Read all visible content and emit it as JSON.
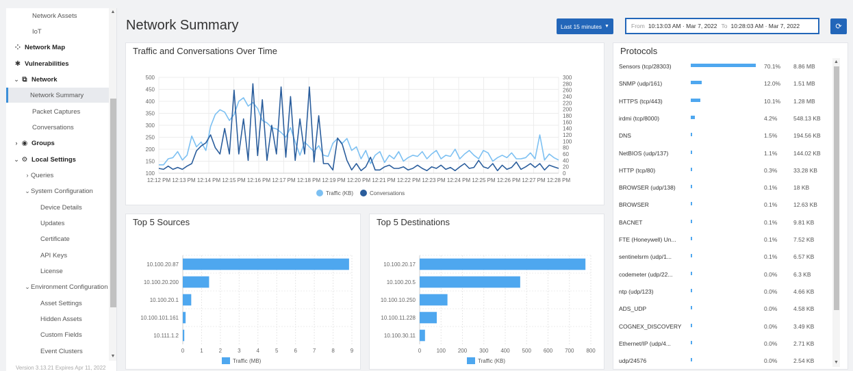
{
  "sidebar": {
    "items": [
      {
        "label": "Network Assets",
        "level": 2
      },
      {
        "label": "IoT",
        "level": 2
      },
      {
        "label": "Network Map",
        "icon": "network-map-icon",
        "bold": true
      },
      {
        "label": "Vulnerabilities",
        "icon": "bug-icon",
        "bold": true
      },
      {
        "label": "Network",
        "icon": "network-icon",
        "bold": true,
        "chevron": "down"
      },
      {
        "label": "Network Summary",
        "level": 2,
        "active": true
      },
      {
        "label": "Packet Captures",
        "level": 2
      },
      {
        "label": "Conversations",
        "level": 2
      },
      {
        "label": "Groups",
        "icon": "groups-icon",
        "bold": true,
        "chevron": "right"
      },
      {
        "label": "Local Settings",
        "icon": "settings-icon",
        "bold": true,
        "chevron": "down"
      },
      {
        "label": "Queries",
        "level": 2,
        "chevron": "right"
      },
      {
        "label": "System Configuration",
        "level": 2,
        "chevron": "down"
      },
      {
        "label": "Device Details",
        "level": 3
      },
      {
        "label": "Updates",
        "level": 3
      },
      {
        "label": "Certificate",
        "level": 3
      },
      {
        "label": "API Keys",
        "level": 3
      },
      {
        "label": "License",
        "level": 3
      },
      {
        "label": "Environment Configuration",
        "level": 2,
        "chevron": "down"
      },
      {
        "label": "Asset Settings",
        "level": 3
      },
      {
        "label": "Hidden Assets",
        "level": 3
      },
      {
        "label": "Custom Fields",
        "level": 3
      },
      {
        "label": "Event Clusters",
        "level": 3
      }
    ],
    "version": "Version 3.13.21 Expires Apr 11, 2022"
  },
  "header": {
    "title": "Network Summary",
    "range_button": "Last 15 minutes",
    "date_from_label": "From",
    "date_from": "10:13:03 AM · Mar 7, 2022",
    "date_to_label": "To",
    "date_to": "10:28:03 AM · Mar 7, 2022"
  },
  "colors": {
    "accent": "#2266b9",
    "bar": "#4ea7ef",
    "traffic_line": "#7cc0f2",
    "conversations_line": "#2a5d9c"
  },
  "traffic_card": {
    "title": "Traffic and Conversations Over Time",
    "legend": [
      "Traffic (KB)",
      "Conversations"
    ]
  },
  "sources_card": {
    "title": "Top 5 Sources",
    "legend": "Traffic (MB)"
  },
  "destinations_card": {
    "title": "Top 5 Destinations",
    "legend": "Traffic (KB)"
  },
  "protocols_card": {
    "title": "Protocols",
    "rows": [
      {
        "name": "Sensors (tcp/28303)",
        "pct": "70.1%",
        "size": "8.86 MB",
        "fraction": 0.701
      },
      {
        "name": "SNMP (udp/161)",
        "pct": "12.0%",
        "size": "1.51 MB",
        "fraction": 0.12
      },
      {
        "name": "HTTPS (tcp/443)",
        "pct": "10.1%",
        "size": "1.28 MB",
        "fraction": 0.101
      },
      {
        "name": "irdmi (tcp/8000)",
        "pct": "4.2%",
        "size": "548.13 KB",
        "fraction": 0.042
      },
      {
        "name": "DNS",
        "pct": "1.5%",
        "size": "194.56 KB",
        "fraction": 0.015
      },
      {
        "name": "NetBIOS (udp/137)",
        "pct": "1.1%",
        "size": "144.02 KB",
        "fraction": 0.011
      },
      {
        "name": "HTTP (tcp/80)",
        "pct": "0.3%",
        "size": "33.28 KB",
        "fraction": 0.003
      },
      {
        "name": "BROWSER (udp/138)",
        "pct": "0.1%",
        "size": "18 KB",
        "fraction": 0.001
      },
      {
        "name": "BROWSER",
        "pct": "0.1%",
        "size": "12.63 KB",
        "fraction": 0.001
      },
      {
        "name": "BACNET",
        "pct": "0.1%",
        "size": "9.81 KB",
        "fraction": 0.001
      },
      {
        "name": "FTE (Honeywell) Un...",
        "pct": "0.1%",
        "size": "7.52 KB",
        "fraction": 0.001
      },
      {
        "name": "sentinelsrm (udp/1...",
        "pct": "0.1%",
        "size": "6.57 KB",
        "fraction": 0.001
      },
      {
        "name": "codemeter (udp/22...",
        "pct": "0.0%",
        "size": "6.3 KB",
        "fraction": 0.0005
      },
      {
        "name": "ntp (udp/123)",
        "pct": "0.0%",
        "size": "4.66 KB",
        "fraction": 0.0005
      },
      {
        "name": "ADS_UDP",
        "pct": "0.0%",
        "size": "4.58 KB",
        "fraction": 0.0005
      },
      {
        "name": "COGNEX_DISCOVERY",
        "pct": "0.0%",
        "size": "3.49 KB",
        "fraction": 0.0005
      },
      {
        "name": "Ethernet/IP (udp/4...",
        "pct": "0.0%",
        "size": "2.71 KB",
        "fraction": 0.0005
      },
      {
        "name": "udp/24576",
        "pct": "0.0%",
        "size": "2.54 KB",
        "fraction": 0.0005
      }
    ]
  },
  "chart_data": [
    {
      "type": "line",
      "title": "Traffic and Conversations Over Time",
      "x": [
        "12:12 PM",
        "12:13 PM",
        "12:14 PM",
        "12:15 PM",
        "12:16 PM",
        "12:17 PM",
        "12:18 PM",
        "12:19 PM",
        "12:20 PM",
        "12:21 PM",
        "12:22 PM",
        "12:23 PM",
        "12:24 PM",
        "12:25 PM",
        "12:26 PM",
        "12:27 PM",
        "12:28 PM"
      ],
      "left_ylim": [
        100,
        500
      ],
      "left_ticks": [
        100,
        150,
        200,
        250,
        300,
        350,
        400,
        450,
        500
      ],
      "right_ylim": [
        0,
        300
      ],
      "right_ticks": [
        0,
        20,
        40,
        60,
        80,
        100,
        120,
        140,
        160,
        180,
        200,
        220,
        240,
        260,
        280,
        300
      ],
      "legend_position": "bottom",
      "series": [
        {
          "name": "Traffic (KB)",
          "axis": "left",
          "color": "#7cc0f2",
          "values": [
            135,
            135,
            160,
            165,
            190,
            155,
            175,
            255,
            210,
            230,
            195,
            295,
            345,
            365,
            355,
            320,
            345,
            400,
            415,
            380,
            395,
            370,
            320,
            310,
            290,
            285,
            270,
            250,
            290,
            230,
            175,
            230,
            210,
            190,
            215,
            175,
            170,
            225,
            245,
            225,
            245,
            195,
            210,
            160,
            195,
            140,
            175,
            190,
            145,
            175,
            160,
            190,
            150,
            165,
            175,
            170,
            190,
            160,
            180,
            195,
            160,
            175,
            170,
            200,
            160,
            180,
            195,
            175,
            160,
            195,
            185,
            150,
            165,
            175,
            165,
            185,
            160,
            160,
            165,
            185,
            160,
            260,
            155,
            180,
            165,
            155
          ]
        },
        {
          "name": "Conversations",
          "axis": "right",
          "color": "#2a5d9c",
          "values": [
            15,
            12,
            22,
            12,
            18,
            12,
            22,
            30,
            70,
            85,
            95,
            120,
            80,
            60,
            140,
            60,
            260,
            60,
            170,
            40,
            280,
            55,
            230,
            40,
            150,
            60,
            270,
            50,
            240,
            40,
            170,
            60,
            270,
            35,
            180,
            30,
            30,
            10,
            110,
            90,
            40,
            10,
            30,
            8,
            20,
            50,
            10,
            10,
            20,
            25,
            15,
            15,
            20,
            10,
            15,
            25,
            15,
            8,
            20,
            15,
            25,
            12,
            18,
            8,
            20,
            30,
            15,
            18,
            40,
            20,
            15,
            30,
            8,
            25,
            12,
            18,
            35,
            12,
            20,
            30,
            18,
            30,
            10,
            25,
            20,
            15
          ]
        }
      ]
    },
    {
      "type": "bar",
      "title": "Top 5 Sources",
      "orientation": "horizontal",
      "categories": [
        "10.100.20.87",
        "10.100.20.200",
        "10.100.20.1",
        "10.100.101.161",
        "10.111.1.2"
      ],
      "values": [
        8.85,
        1.4,
        0.45,
        0.15,
        0.08
      ],
      "xlim": [
        0,
        9
      ],
      "xticks": [
        0,
        1,
        2,
        3,
        4,
        5,
        6,
        7,
        8,
        9
      ],
      "legend": "Traffic (MB)",
      "color": "#4ea7ef"
    },
    {
      "type": "bar",
      "title": "Top 5 Destinations",
      "orientation": "horizontal",
      "categories": [
        "10.100.20.17",
        "10.100.20.5",
        "10.100.10.250",
        "10.100.11.228",
        "10.100.30.11"
      ],
      "values": [
        775,
        470,
        130,
        80,
        25
      ],
      "xlim": [
        0,
        800
      ],
      "xticks": [
        0,
        100,
        200,
        300,
        400,
        500,
        600,
        700,
        800
      ],
      "legend": "Traffic (KB)",
      "color": "#4ea7ef"
    }
  ]
}
